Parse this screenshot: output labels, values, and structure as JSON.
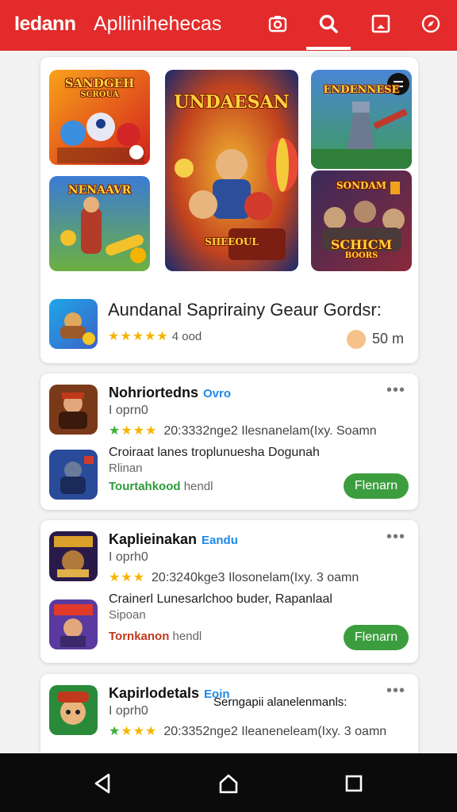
{
  "header": {
    "brand": "Iedann",
    "title": "Apllinihehecas",
    "icons": [
      "camera-icon",
      "search-icon",
      "tablet-icon",
      "compass-icon"
    ],
    "active_tab": "search"
  },
  "featured": {
    "tiles": [
      {
        "label": "SANDGEH",
        "subtitle": "SCROUA"
      },
      {
        "label": "UNDAESAN",
        "subtitle": "SIIEEOUL"
      },
      {
        "label": "NENAAVR",
        "subtitle": ""
      },
      {
        "label": "ENDENNESE",
        "subtitle": ""
      },
      {
        "label": "SONDAM",
        "subtitle": ""
      },
      {
        "label": "SCHICM",
        "subtitle": "BOORS"
      }
    ],
    "title": "Aundanal Saprirainy Geaur Gordsr:",
    "rating_stars": "★★★★★",
    "rating_text": "4 ood",
    "size": "50 m"
  },
  "list": [
    {
      "title": "Nohriortedns",
      "tag": "Ovro",
      "subtitle": "I oprn0",
      "stars": "★★★",
      "meta": "20:3332nge2  Ilesnanelam(Ixy. Soamn",
      "desc1": "Croiraat lanes  troplunuesha Dogunah",
      "desc2": "Rlinan",
      "trend_label": "Tourtahkood",
      "trend_rest": " hendl",
      "button": "Flenarn"
    },
    {
      "title": "Kaplieinakan",
      "tag": "Eandu",
      "subtitle": "I oprh0",
      "stars": "★★★",
      "meta": "20:3240kge3  Ilosonelam(Ixy. 3 oamn",
      "desc1": "Crainerl Lunesarlchoo buder, Rapanlaal",
      "desc2": "Sipoan",
      "trend_label": "Tornkanon",
      "trend_rest": " hendl",
      "button": "Flenarn"
    },
    {
      "title": "Kapirlodetals",
      "tag": "Eoin",
      "subtitle": "I oprh0",
      "stars": "★★★",
      "meta": "20:3352nge2  Ileaneneleam(Ixy. 3 oamn",
      "overlay": "Serngapii alanelenmanls:"
    }
  ]
}
